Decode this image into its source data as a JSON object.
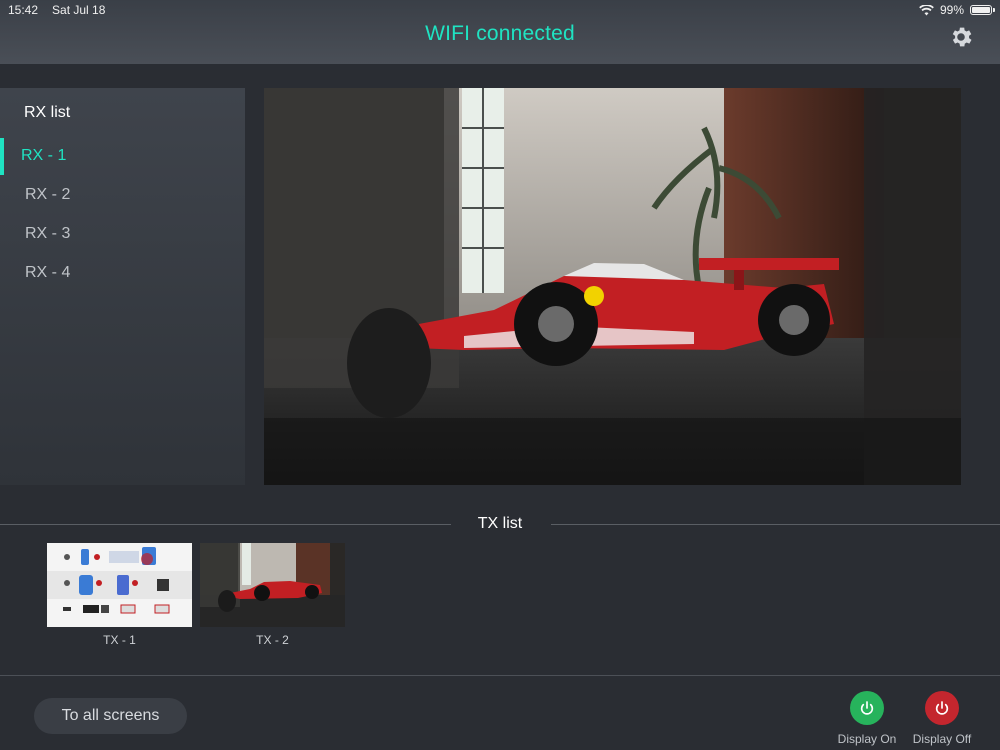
{
  "status": {
    "time": "15:42",
    "date": "Sat Jul 18",
    "battery": "99%",
    "battery_level": 0.99
  },
  "header": {
    "title": "WIFI connected"
  },
  "rx": {
    "title": "RX list",
    "items": [
      {
        "label": "RX - 1",
        "active": true
      },
      {
        "label": "RX - 2",
        "active": false
      },
      {
        "label": "RX - 3",
        "active": false
      },
      {
        "label": "RX - 4",
        "active": false
      }
    ]
  },
  "tx": {
    "title": "TX list",
    "items": [
      {
        "label": "TX - 1"
      },
      {
        "label": "TX - 2"
      }
    ]
  },
  "footer": {
    "all_screens_label": "To all screens",
    "display_on_label": "Display On",
    "display_off_label": "Display Off"
  },
  "colors": {
    "accent": "#1fe3c2",
    "display_on": "#27b35c",
    "display_off": "#c4262e",
    "background": "#2a2d33"
  }
}
